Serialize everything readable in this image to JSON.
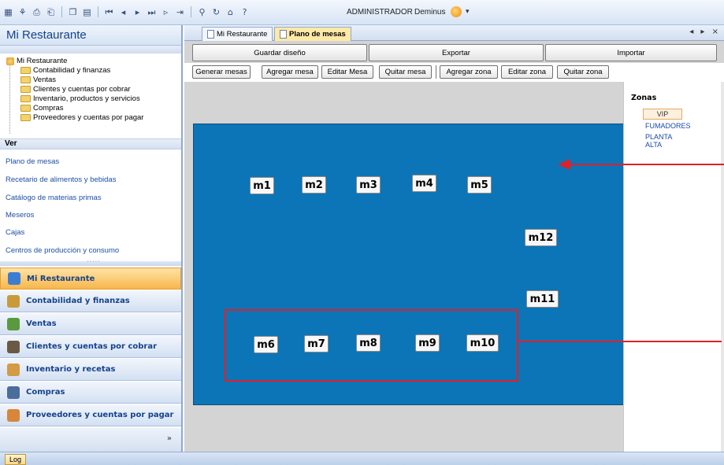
{
  "toolbar": {
    "icons": [
      "grid-icon",
      "tree-icon",
      "print-preview-icon",
      "print-icon",
      "copy-icon",
      "paste-icon",
      "first-icon",
      "prev-icon",
      "next-icon",
      "last-icon",
      "new-icon",
      "end-icon",
      "search-icon",
      "refresh-icon",
      "home-icon",
      "help-icon"
    ],
    "user": "ADMINISTRADOR",
    "company": "Deminus"
  },
  "leftpane": {
    "title": "Mi Restaurante",
    "tree": {
      "root": "Mi Restaurante",
      "items": [
        "Contabilidad y finanzas",
        "Ventas",
        "Clientes y cuentas por cobrar",
        "Inventario, productos y servicios",
        "Compras",
        "Proveedores y cuentas por pagar"
      ]
    },
    "ver_header": "Ver",
    "ver_links": [
      "Plano de mesas",
      "Recetario de alimentos y bebidas",
      "Catálogo de materias primas",
      "Meseros",
      "Cajas",
      "Centros de producción y consumo"
    ],
    "nav_buttons": [
      {
        "label": "Mi Restaurante",
        "active": true,
        "color": "#3d7dd1"
      },
      {
        "label": "Contabilidad y finanzas",
        "active": false,
        "color": "#c99a3a"
      },
      {
        "label": "Ventas",
        "active": false,
        "color": "#5a9a3f"
      },
      {
        "label": "Clientes y cuentas por cobrar",
        "active": false,
        "color": "#6a5a45"
      },
      {
        "label": "Inventario y recetas",
        "active": false,
        "color": "#d49a46"
      },
      {
        "label": "Compras",
        "active": false,
        "color": "#4a6d9c"
      },
      {
        "label": "Proveedores y cuentas por pagar",
        "active": false,
        "color": "#d7863b"
      }
    ],
    "footer_chevron": "»"
  },
  "tabs": [
    {
      "label": "Mi Restaurante",
      "active": false
    },
    {
      "label": "Plano de mesas",
      "active": true
    }
  ],
  "tab_controls": "◂ ▸ ×",
  "main": {
    "top_buttons": [
      "Guardar diseño",
      "Exportar",
      "Importar"
    ],
    "action_buttons": [
      "Generar mesas",
      "Agregar mesa",
      "Editar Mesa",
      "Quitar mesa",
      "Agregar zona",
      "Editar zona",
      "Quitar zona"
    ],
    "floor_color": "#0b75b7",
    "mesas": [
      "m1",
      "m2",
      "m3",
      "m4",
      "m5",
      "m12",
      "m11",
      "m6",
      "m7",
      "m8",
      "m9",
      "m10"
    ]
  },
  "zones": {
    "title": "Zonas",
    "items": [
      "VIP",
      "FUMADORES",
      "PLANTA ALTA"
    ],
    "selected": "VIP"
  },
  "statusbar": {
    "log_label": "Log"
  },
  "annotation_color": "#e0202a"
}
